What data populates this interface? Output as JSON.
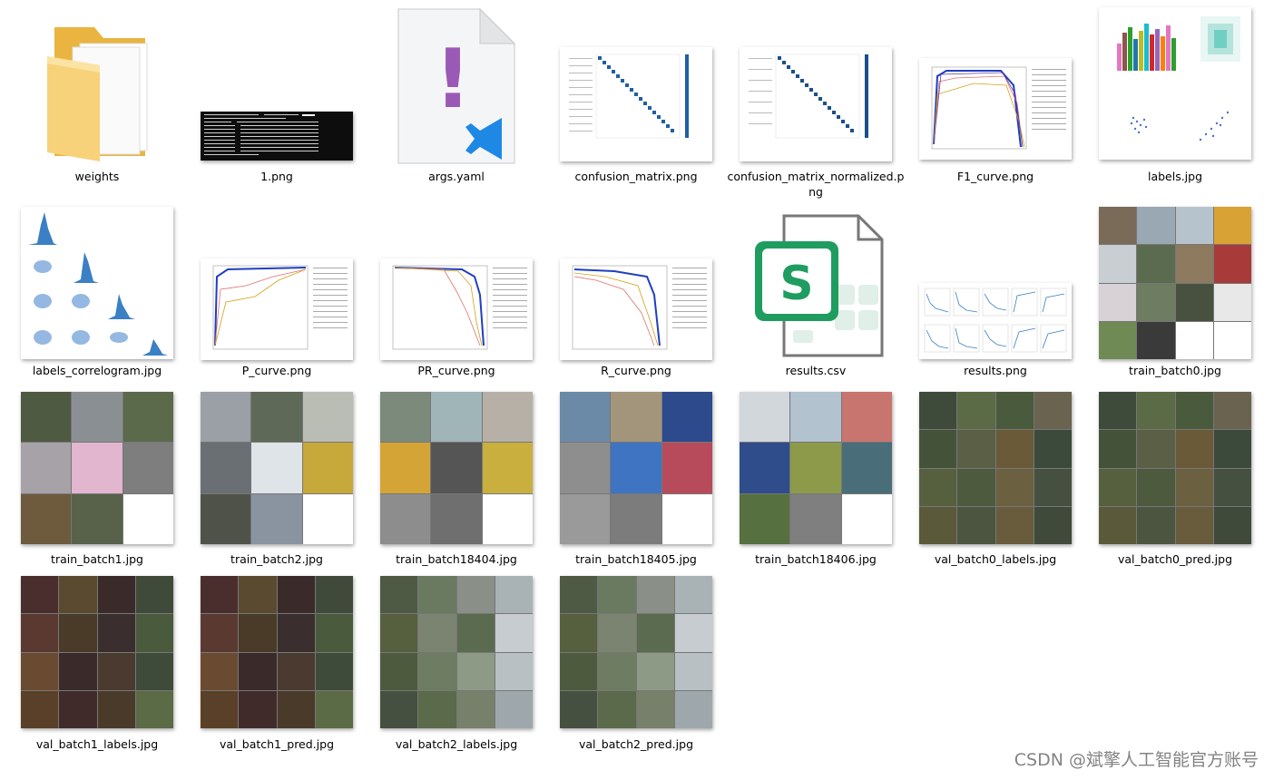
{
  "files": [
    {
      "name": "weights",
      "kind": "folder"
    },
    {
      "name": "1.png",
      "kind": "terminal"
    },
    {
      "name": "args.yaml",
      "kind": "yaml"
    },
    {
      "name": "confusion_matrix.png",
      "kind": "matrix"
    },
    {
      "name": "confusion_matrix_normalized.png",
      "kind": "matrix"
    },
    {
      "name": "F1_curve.png",
      "kind": "curve"
    },
    {
      "name": "labels.jpg",
      "kind": "labels"
    },
    {
      "name": "labels_correlogram.jpg",
      "kind": "correlogram"
    },
    {
      "name": "P_curve.png",
      "kind": "curve"
    },
    {
      "name": "PR_curve.png",
      "kind": "curve"
    },
    {
      "name": "R_curve.png",
      "kind": "curve"
    },
    {
      "name": "results.csv",
      "kind": "csv"
    },
    {
      "name": "results.png",
      "kind": "results"
    },
    {
      "name": "train_batch0.jpg",
      "kind": "photo"
    },
    {
      "name": "train_batch1.jpg",
      "kind": "photo"
    },
    {
      "name": "train_batch2.jpg",
      "kind": "photo"
    },
    {
      "name": "train_batch18404.jpg",
      "kind": "photo"
    },
    {
      "name": "train_batch18405.jpg",
      "kind": "photo"
    },
    {
      "name": "train_batch18406.jpg",
      "kind": "photo"
    },
    {
      "name": "val_batch0_labels.jpg",
      "kind": "photo"
    },
    {
      "name": "val_batch0_pred.jpg",
      "kind": "photo"
    },
    {
      "name": "val_batch1_labels.jpg",
      "kind": "photo"
    },
    {
      "name": "val_batch1_pred.jpg",
      "kind": "photo"
    },
    {
      "name": "val_batch2_labels.jpg",
      "kind": "photo"
    },
    {
      "name": "val_batch2_pred.jpg",
      "kind": "photo"
    }
  ],
  "thumb_text": {
    "csv_glyph": "S",
    "yaml_glyph": "!"
  },
  "watermark": "CSDN @斌擎人工智能官方账号",
  "colors": {
    "folder": "#f5c85a",
    "csv_green": "#1f9d60",
    "yaml_purple": "#9b59b6",
    "vscode_blue": "#1e88e5",
    "matrix_blue": "#1f5fa5"
  }
}
